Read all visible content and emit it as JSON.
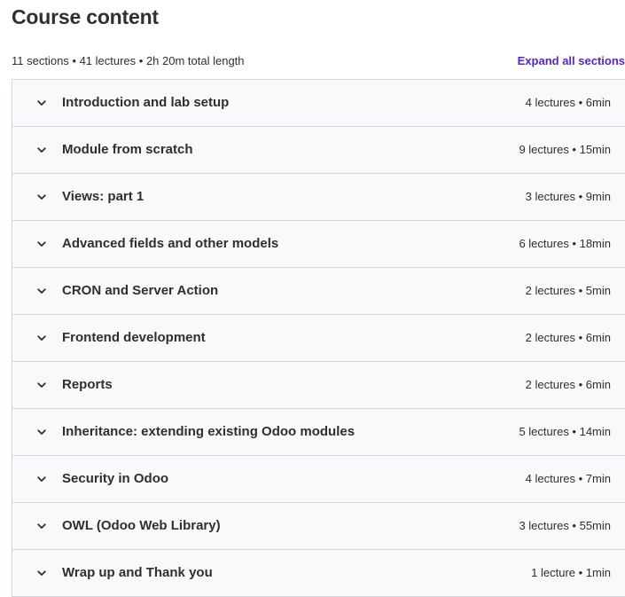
{
  "header": {
    "title": "Course content",
    "summary": "11 sections • 41 lectures • 2h 20m total length",
    "expand_all_label": "Expand all sections"
  },
  "colors": {
    "accent": "#5624d0",
    "section_bg": "#f7f9fa",
    "border": "#d1d7dc",
    "text": "#2d2f31"
  },
  "sections": [
    {
      "title": "Introduction and lab setup",
      "meta": "4 lectures • 6min",
      "icon": "chevron-down-icon"
    },
    {
      "title": "Module from scratch",
      "meta": "9 lectures • 15min",
      "icon": "chevron-down-icon"
    },
    {
      "title": "Views: part 1",
      "meta": "3 lectures • 9min",
      "icon": "chevron-down-icon"
    },
    {
      "title": "Advanced fields and other models",
      "meta": "6 lectures • 18min",
      "icon": "chevron-down-icon"
    },
    {
      "title": "CRON and Server Action",
      "meta": "2 lectures • 5min",
      "icon": "chevron-down-icon"
    },
    {
      "title": "Frontend development",
      "meta": "2 lectures • 6min",
      "icon": "chevron-down-icon"
    },
    {
      "title": "Reports",
      "meta": "2 lectures • 6min",
      "icon": "chevron-down-icon"
    },
    {
      "title": "Inheritance: extending existing Odoo modules",
      "meta": "5 lectures • 14min",
      "icon": "chevron-down-icon"
    },
    {
      "title": "Security in Odoo",
      "meta": "4 lectures • 7min",
      "icon": "chevron-down-icon"
    },
    {
      "title": "OWL (Odoo Web Library)",
      "meta": "3 lectures • 55min",
      "icon": "chevron-down-icon"
    },
    {
      "title": "Wrap up and Thank you",
      "meta": "1 lecture • 1min",
      "icon": "chevron-down-icon"
    }
  ]
}
